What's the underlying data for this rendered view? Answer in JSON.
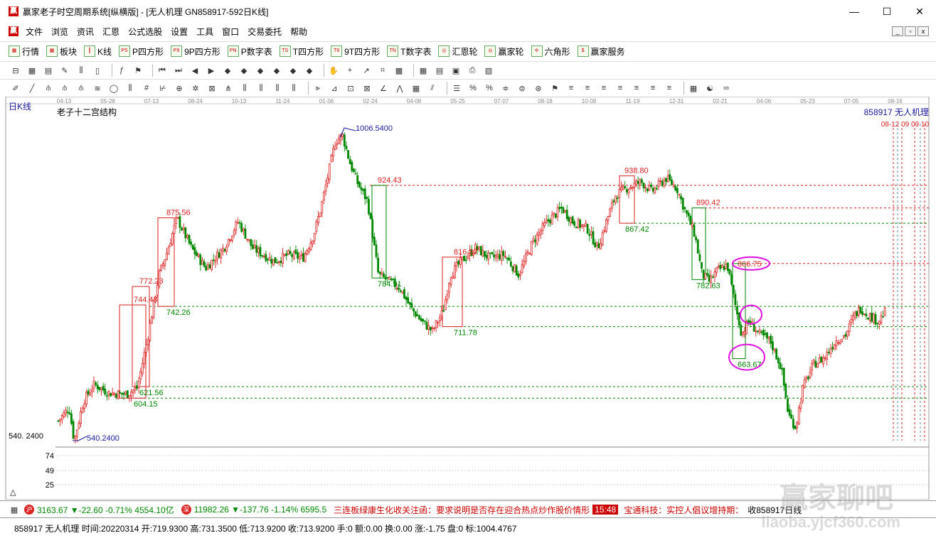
{
  "window": {
    "title": "赢家老子时空周期系统[纵横版] - [无人机理  GN858917-592日K线]",
    "app_icon": "赢",
    "minimize": "—",
    "maximize": "☐",
    "close": "✕"
  },
  "menu": {
    "logo": "赢",
    "items": [
      "文件",
      "浏览",
      "资讯",
      "汇恩",
      "公式选股",
      "设置",
      "工具",
      "窗口",
      "交易委托",
      "帮助"
    ]
  },
  "toolbar1": {
    "items": [
      {
        "icon": "▦",
        "label": "行情"
      },
      {
        "icon": "▦",
        "label": "板块"
      },
      {
        "icon": "┃",
        "label": "K线"
      },
      {
        "icon": "PS",
        "label": "P四方形"
      },
      {
        "icon": "P9",
        "label": "9P四方形"
      },
      {
        "icon": "PN",
        "label": "P数字表"
      },
      {
        "icon": "TS",
        "label": "T四方形"
      },
      {
        "icon": "T9",
        "label": "9T四方形"
      },
      {
        "icon": "TN",
        "label": "T数字表"
      },
      {
        "icon": "◎",
        "label": "汇恩轮"
      },
      {
        "icon": "◎",
        "label": "赢家轮"
      },
      {
        "icon": "✡",
        "label": "六角形"
      },
      {
        "icon": "$",
        "label": "赢家服务"
      }
    ]
  },
  "chart": {
    "panel_label": "日K线",
    "indicator_name": "老子十二宫结构",
    "symbol_label": "858917  无人机理",
    "top_dates": [
      "04-13",
      "05-28",
      "07-13",
      "08-24",
      "10-13",
      "11-24",
      "01-06",
      "02-24",
      "04-08",
      "05-25",
      "07-07",
      "08-18",
      "10-08",
      "11-19",
      "12-31",
      "02-21",
      "04-06",
      "05-23",
      "07-05",
      "08-16"
    ],
    "axis_low_label": "540. 2400",
    "sub_ticks": [
      "74",
      "49",
      "25"
    ],
    "scroll_label": "△",
    "right_tags": "08-12 09 09 10"
  },
  "chart_data": {
    "type": "candlestick",
    "title": "老子十二宫结构",
    "high_marker": 1006.54,
    "low_marker": 540.24,
    "annotations": [
      {
        "text": "1006.5400",
        "value": 1006.54,
        "color": "#1a1aa0"
      },
      {
        "text": "924.43",
        "value": 924.43,
        "color": "#d22"
      },
      {
        "text": "938.80",
        "value": 938.8,
        "color": "#d22"
      },
      {
        "text": "890.42",
        "value": 890.42,
        "color": "#d22"
      },
      {
        "text": "875.56",
        "value": 875.56,
        "color": "#d22"
      },
      {
        "text": "867.42",
        "value": 867.42,
        "color": "#080"
      },
      {
        "text": "816.37",
        "value": 816.37,
        "color": "#d22"
      },
      {
        "text": "806.75",
        "value": 806.75,
        "color": "#d22"
      },
      {
        "text": "784.91",
        "value": 784.91,
        "color": "#080"
      },
      {
        "text": "782.63",
        "value": 782.63,
        "color": "#080"
      },
      {
        "text": "772.23",
        "value": 772.23,
        "color": "#d22"
      },
      {
        "text": "744.48",
        "value": 744.48,
        "color": "#d22"
      },
      {
        "text": "742.26",
        "value": 742.26,
        "color": "#080"
      },
      {
        "text": "711.78",
        "value": 711.78,
        "color": "#080"
      },
      {
        "text": "663.67",
        "value": 663.67,
        "color": "#080"
      },
      {
        "text": "621.56",
        "value": 621.56,
        "color": "#080"
      },
      {
        "text": "604.15",
        "value": 604.15,
        "color": "#080"
      },
      {
        "text": "540.2400",
        "value": 540.24,
        "color": "#1a1aa0"
      }
    ],
    "ylim": [
      540.24,
      1006.54
    ]
  },
  "status1": {
    "idx1_icon": "沪",
    "idx1_text": "3163.67 ▼-22.60 -0.71% 4554.10亿",
    "idx2_icon": "深",
    "idx2_text": "11982.26 ▼-137.76 -1.14% 6595.5",
    "ticker": "三连板绿康生化收关注函：要求说明是否存在迎合热点炒作股价情形",
    "time": "15:48",
    "ticker2": "宝通科技：实控人倡议增持期：",
    "right_text": "收858917日线"
  },
  "status2": {
    "text": "858917 无人机理 时间:20220314 开:719.9300 高:731.3500 低:713.9200 收:713.9200 手:0 额:0.00 换:0.00 涨:-1.75 盘:0 标:1004.4767"
  },
  "watermark": {
    "line1": "赢家聊吧",
    "line2": "liaoba.yjcf360.com"
  },
  "colors": {
    "up": "#d22",
    "down": "#080",
    "accent": "#c00",
    "blue": "#1a1aa0",
    "magenta": "#e010e0"
  }
}
